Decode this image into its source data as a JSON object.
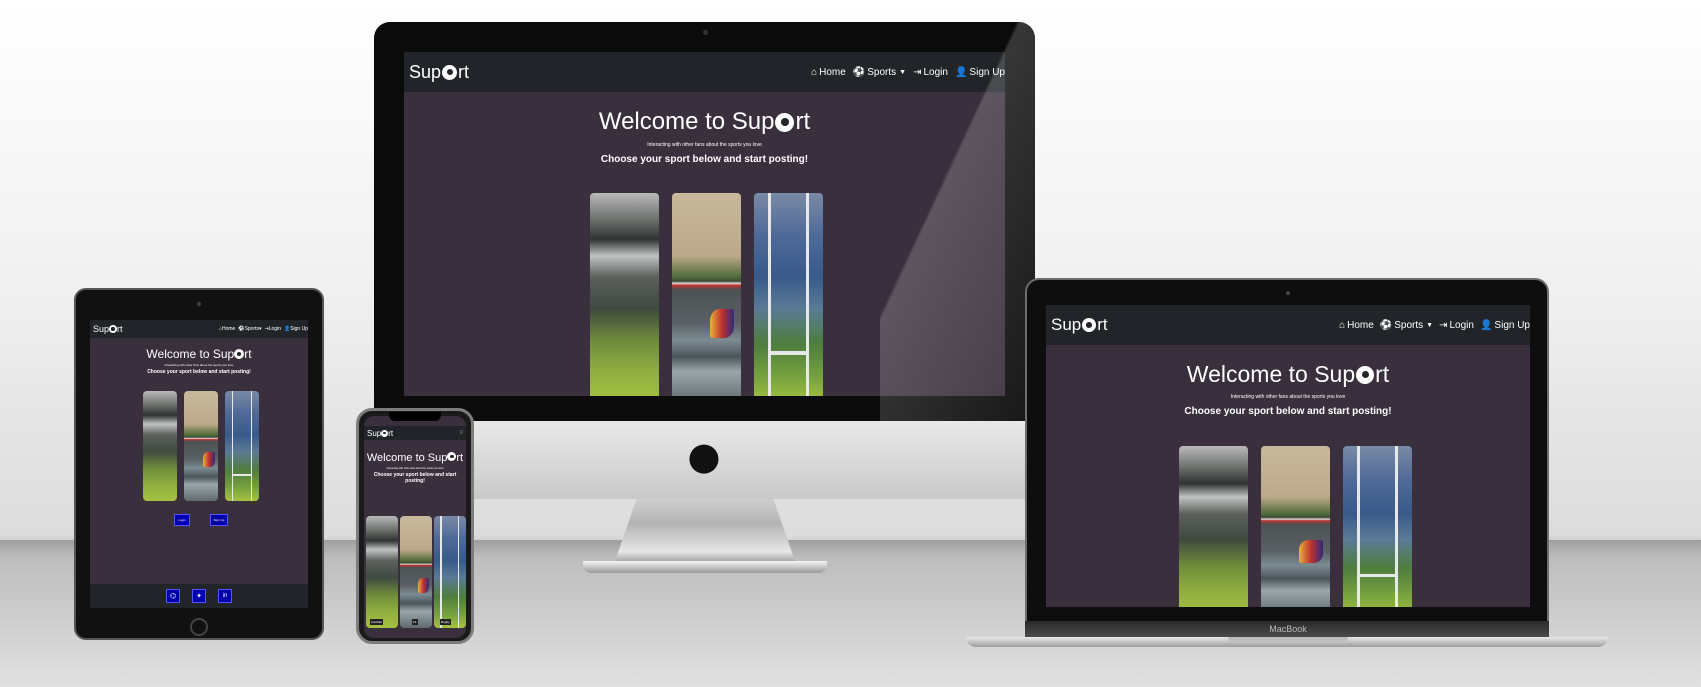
{
  "site": {
    "brand": "Sup⚽rt",
    "brand_prefix": "Sup",
    "brand_suffix": "rt",
    "nav": {
      "home": "Home",
      "sports": "Sports",
      "login": "Login",
      "signup": "Sign Up"
    },
    "hero": {
      "title_prefix": "Welcome to Sup",
      "title_suffix": "rt",
      "subtitle": "Interacting with other fans about the sports you love",
      "choose": "Choose your sport below and start posting!"
    },
    "buttons": {
      "login": "Login",
      "signup": "Sign Up"
    },
    "mobile_card_labels": [
      "Football",
      "F1",
      "Rugby"
    ]
  },
  "devices": {
    "laptop_label": "MacBook"
  },
  "colors": {
    "page_bg": "#3a2f3c",
    "navbar": "#212529",
    "button": "#0000aa"
  },
  "icons": [
    "home-icon",
    "football-icon",
    "chevron-down-icon",
    "login-icon",
    "user-plus-icon",
    "apple-logo-icon",
    "github-icon",
    "twitter-icon",
    "linkedin-icon",
    "hamburger-icon"
  ]
}
